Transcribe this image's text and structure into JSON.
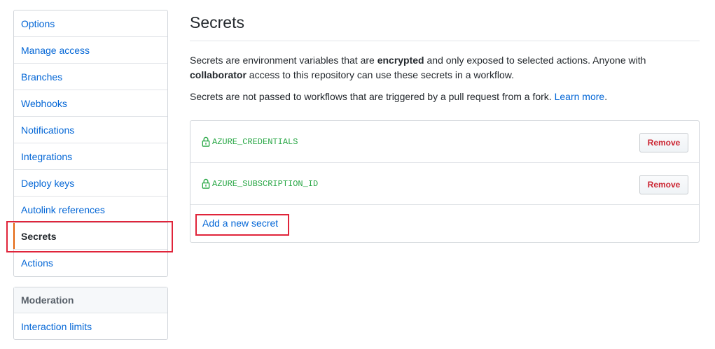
{
  "sidebar": {
    "items": [
      {
        "label": "Options"
      },
      {
        "label": "Manage access"
      },
      {
        "label": "Branches"
      },
      {
        "label": "Webhooks"
      },
      {
        "label": "Notifications"
      },
      {
        "label": "Integrations"
      },
      {
        "label": "Deploy keys"
      },
      {
        "label": "Autolink references"
      },
      {
        "label": "Secrets"
      },
      {
        "label": "Actions"
      }
    ],
    "moderation": {
      "header": "Moderation",
      "items": [
        {
          "label": "Interaction limits"
        }
      ]
    }
  },
  "main": {
    "title": "Secrets",
    "description1": {
      "part1": "Secrets are environment variables that are ",
      "bold1": "encrypted",
      "part2": " and only exposed to selected actions. Anyone with ",
      "bold2": "collaborator",
      "part3": " access to this repository can use these secrets in a workflow."
    },
    "description2": {
      "text": "Secrets are not passed to workflows that are triggered by a pull request from a fork. ",
      "link": "Learn more",
      "end": "."
    },
    "secrets": [
      {
        "name": "AZURE_CREDENTIALS",
        "action": "Remove"
      },
      {
        "name": "AZURE_SUBSCRIPTION_ID",
        "action": "Remove"
      }
    ],
    "add_label": "Add a new secret"
  },
  "colors": {
    "link": "#0366d6",
    "secret_name": "#28a745",
    "remove_text": "#cb2431",
    "selected_marker": "#e36209",
    "highlight_box": "#e0243a"
  },
  "icons": {
    "secret_lock": "lock-icon"
  }
}
